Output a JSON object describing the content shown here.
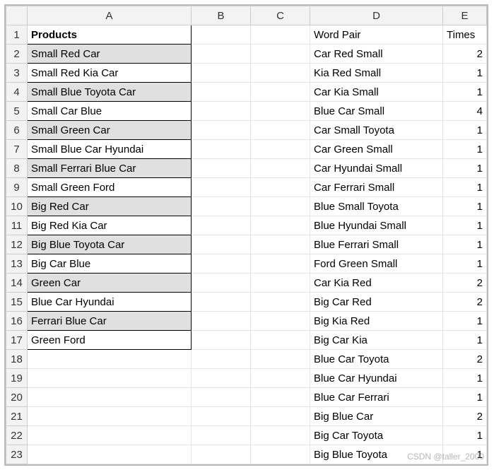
{
  "columns": [
    "A",
    "B",
    "C",
    "D",
    "E"
  ],
  "rowNumbers": [
    1,
    2,
    3,
    4,
    5,
    6,
    7,
    8,
    9,
    10,
    11,
    12,
    13,
    14,
    15,
    16,
    17,
    18,
    19,
    20,
    21,
    22,
    23
  ],
  "header": {
    "A": "Products",
    "D": "Word Pair",
    "E": "Times"
  },
  "colA": [
    {
      "text": "Small Red Car",
      "shade": true
    },
    {
      "text": "Small Red Kia Car",
      "shade": false
    },
    {
      "text": "Small Blue Toyota Car",
      "shade": true
    },
    {
      "text": "Small Car Blue",
      "shade": false
    },
    {
      "text": "Small Green Car",
      "shade": true
    },
    {
      "text": "Small Blue Car Hyundai",
      "shade": false
    },
    {
      "text": "Small Ferrari Blue Car",
      "shade": true
    },
    {
      "text": "Small Green Ford",
      "shade": false
    },
    {
      "text": "Big Red Car",
      "shade": true
    },
    {
      "text": "Big Red Kia Car",
      "shade": false
    },
    {
      "text": "Big Blue Toyota Car",
      "shade": true
    },
    {
      "text": "Big Car Blue",
      "shade": false
    },
    {
      "text": "Green Car",
      "shade": true
    },
    {
      "text": "Blue Car Hyundai",
      "shade": false
    },
    {
      "text": "Ferrari Blue Car",
      "shade": true
    },
    {
      "text": "Green Ford",
      "shade": false
    }
  ],
  "colD": [
    "Car Red Small",
    "Kia Red Small",
    "Car Kia Small",
    "Blue Car Small",
    "Car Small Toyota",
    "Car Green Small",
    "Car Hyundai Small",
    "Car Ferrari Small",
    "Blue Small Toyota",
    "Blue Hyundai Small",
    "Blue Ferrari Small",
    "Ford Green Small",
    "Car Kia Red",
    "Big Car Red",
    "Big Kia Red",
    "Big Car Kia",
    "Blue Car Toyota",
    "Blue Car Hyundai",
    "Blue Car Ferrari",
    "Big Blue Car",
    "Big Car Toyota",
    "Big Blue Toyota"
  ],
  "colE": [
    2,
    1,
    1,
    4,
    1,
    1,
    1,
    1,
    1,
    1,
    1,
    1,
    2,
    2,
    1,
    1,
    2,
    1,
    1,
    2,
    1,
    1
  ],
  "watermark": "CSDN @taller_2000"
}
